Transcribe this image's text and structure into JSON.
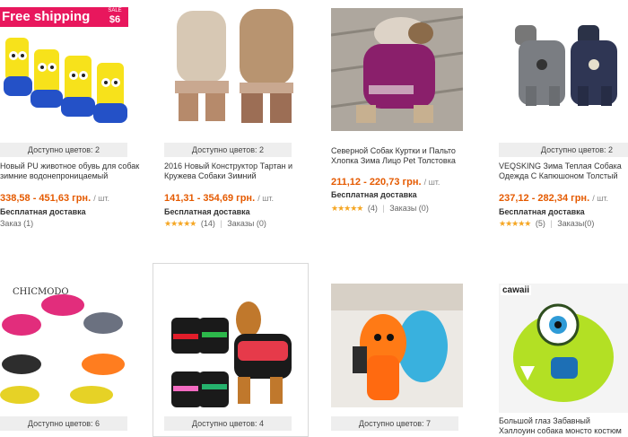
{
  "products": [
    {
      "ribbon": "Free shipping",
      "sale_label": "SALE",
      "sale_price": "$6",
      "colors": "Доступно цветов: 2",
      "title": "Новый PU животное обувь для собак зимние водонепроницаемый",
      "price": "338,58 - 451,63 грн.",
      "unit": "/ шт.",
      "shipping": "Бесплатная доставка",
      "orders": "Заказ (1)"
    },
    {
      "colors": "Доступно цветов: 2",
      "title": "2016 Новый Конструктор Тартан и Кружева Собаки Зимний",
      "price": "141,31 - 354,69 грн.",
      "unit": "/ шт.",
      "shipping": "Бесплатная доставка",
      "stars": "★★★★★",
      "reviews": "(14)",
      "orders": "Заказы (0)"
    },
    {
      "title": "Северной Собак Куртки и Пальто Хлопка Зима Лицо Pet Толстовка",
      "price": "211,12 - 220,73 грн.",
      "unit": "/ шт.",
      "shipping": "Бесплатная доставка",
      "stars": "★★★★★",
      "reviews": "(4)",
      "orders": "Заказы (0)"
    },
    {
      "colors": "Доступно цветов: 2",
      "title": "VEQSKING Зима Теплая Собака Одежда С Капюшоном Толстый",
      "price": "237,12 - 282,34 грн.",
      "unit": "/ шт.",
      "shipping": "Бесплатная доставка",
      "stars": "★★★★★",
      "reviews": "(5)",
      "orders": "Заказы(0)"
    },
    {
      "brand": "CHICMODO",
      "colors": "Доступно цветов: 6"
    },
    {
      "colors": "Доступно цветов: 4"
    },
    {
      "colors": "Доступно цветов: 7"
    },
    {
      "brand": "cawaii",
      "title": "Большой глаз Забавный Хэллоуин собака монсто костюм зимний"
    }
  ],
  "colors": {
    "price": "#e55a00",
    "stars": "#f5a623",
    "ribbon": "#e8175d"
  }
}
